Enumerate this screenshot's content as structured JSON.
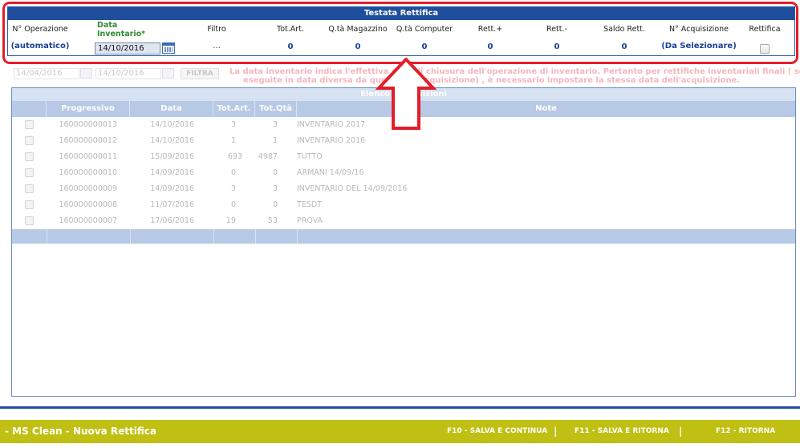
{
  "header": {
    "title": "Testata Rettifica",
    "operation_label": "N° Operazione",
    "operation_value": "(automatico)",
    "date_label_line1": "Data",
    "date_label_line2": "Inventario*",
    "date_value": "14/10/2016",
    "filter_label": "Filtro",
    "filter_value": "...",
    "tot_art_label": "Tot.Art.",
    "tot_art_value": "0",
    "qta_magazzino_label": "Q.tà Magazzino",
    "qta_magazzino_value": "0",
    "qta_computer_label": "Q.tà Computer",
    "qta_computer_value": "0",
    "rett_plus_label": "Rett.+",
    "rett_plus_value": "0",
    "rett_minus_label": "Rett.-",
    "rett_minus_value": "0",
    "saldo_label": "Saldo Rett.",
    "saldo_value": "0",
    "acquisizione_label": "N° Acquisizione",
    "acquisizione_value": "(Da Selezionare)",
    "rettifica_label": "Rettifica"
  },
  "filter_row": {
    "date_from": "14/04/2016",
    "date_to": "14/10/2016",
    "button_label": "FILTRA"
  },
  "notice": {
    "line1": "La data inventario indica l'effettiva data di chiusura dell'operazione di inventario. Pertanto per rettifiche inventariali finali ( se",
    "line2": "eseguite in data diversa da quella dell'acquisizione) , è necessario impostare la stessa data dell'acquisizione."
  },
  "table": {
    "title": "Elenco Acquisizioni",
    "columns": [
      "",
      "Progressivo",
      "Data",
      "Tot.Art.",
      "Tot.Qtà",
      "Note"
    ],
    "rows": [
      {
        "progressivo": "160000000013",
        "data": "14/10/2016",
        "tot_art": "3",
        "tot_qta": "3",
        "note": "INVENTARIO 2017"
      },
      {
        "progressivo": "160000000012",
        "data": "14/10/2016",
        "tot_art": "1",
        "tot_qta": "1",
        "note": "INVENTARIO 2016"
      },
      {
        "progressivo": "160000000011",
        "data": "15/09/2016",
        "tot_art": "693",
        "tot_qta": "4987",
        "note": "TUTTO"
      },
      {
        "progressivo": "160000000010",
        "data": "14/09/2016",
        "tot_art": "0",
        "tot_qta": "0",
        "note": "ARMANI 14/09/16"
      },
      {
        "progressivo": "160000000009",
        "data": "14/09/2016",
        "tot_art": "3",
        "tot_qta": "3",
        "note": "INVENTARIO DEL 14/09/2016"
      },
      {
        "progressivo": "160000000008",
        "data": "11/07/2016",
        "tot_art": "0",
        "tot_qta": "0",
        "note": "TESDT"
      },
      {
        "progressivo": "160000000007",
        "data": "17/06/2016",
        "tot_art": "19",
        "tot_qta": "53",
        "note": "PROVA"
      }
    ]
  },
  "bottom_bar": {
    "title": "- MS Clean - Nuova Rettifica",
    "f10": "F10 - SALVA E CONTINUA",
    "f11": "F11 - SALVA E RITORNA",
    "f12": "F12 - RITORNA",
    "separator": "|"
  },
  "colors": {
    "header_blue": "#1f4e9c",
    "highlight_red": "#e31e2b",
    "bottom_bar": "#c0bf13",
    "date_label_green": "#2e8b2e",
    "value_blue": "#1a3f96"
  },
  "icons": {
    "calendar": "calendar-icon",
    "annotation_arrow": "up-arrow-icon"
  }
}
